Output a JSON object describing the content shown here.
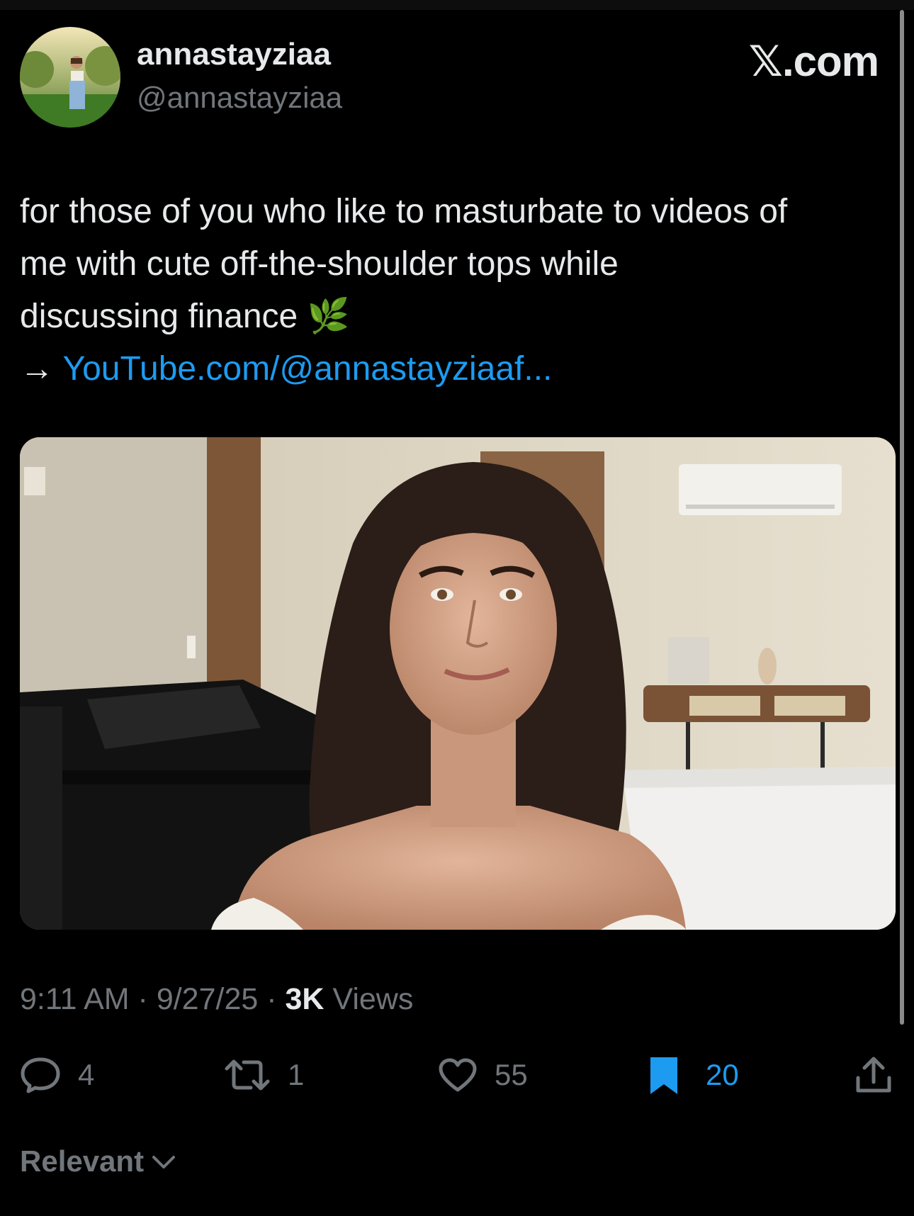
{
  "author": {
    "display_name": "annastayziaa",
    "handle": "@annastayziaa"
  },
  "watermark": "𝕏.com",
  "tweet": {
    "text_lines": [
      "for those of you who like to masturbate to videos of",
      "me with cute off-the-shoulder tops while",
      "discussing finance"
    ],
    "emoji": "🌿",
    "arrow": "→",
    "link_text": "YouTube.com/@annastayziaaf..."
  },
  "meta": {
    "time": "9:11 AM",
    "separator": "·",
    "date": "9/27/25",
    "views_count": "3K",
    "views_label": "Views"
  },
  "actions": {
    "replies": "4",
    "reposts": "1",
    "likes": "55",
    "bookmarks": "20"
  },
  "sort": {
    "label": "Relevant"
  },
  "colors": {
    "background": "#000000",
    "text": "#e7e9ea",
    "secondary": "#71767b",
    "accent": "#1d9bf0"
  }
}
